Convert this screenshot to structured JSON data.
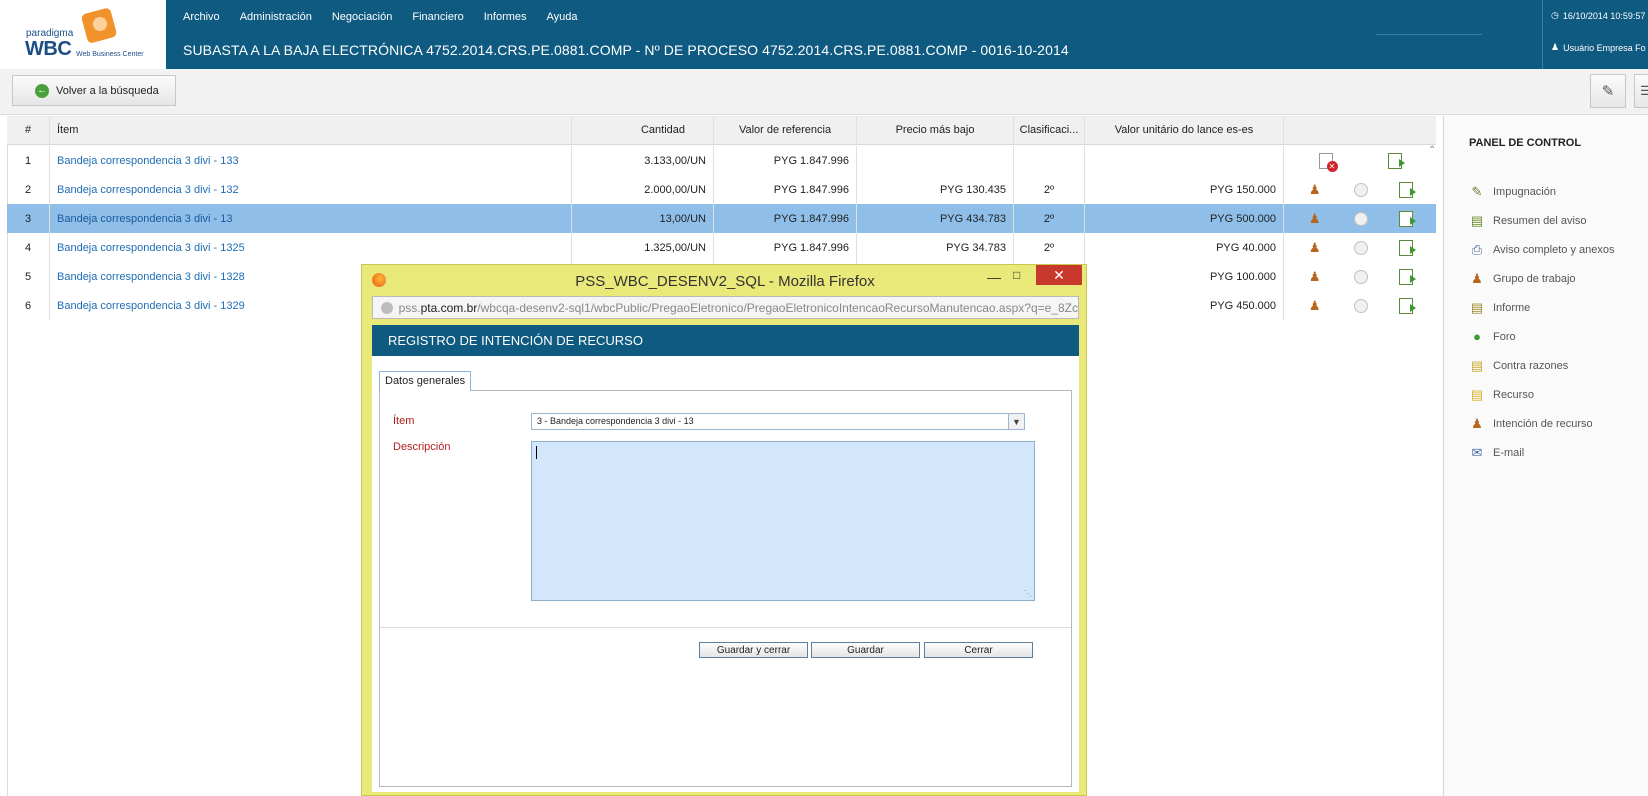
{
  "brand": {
    "small": "paradigma",
    "name": "WBC",
    "tagline": "Web Business Center"
  },
  "menu": [
    "Archivo",
    "Administración",
    "Negociación",
    "Financiero",
    "Informes",
    "Ayuda"
  ],
  "page_title": "SUBASTA A LA BAJA ELECTRÓNICA 4752.2014.CRS.PE.0881.COMP - Nº DE PROCESO 4752.2014.CRS.PE.0881.COMP - 0016-10-2014",
  "datetime": "16/10/2014 10:59:57",
  "user": "Usuário Empresa Fo",
  "toolbar": {
    "back_label": "Volver a la búsqueda"
  },
  "table": {
    "headers": [
      "#",
      "Ítem",
      "Cantidad",
      "Valor de referencia",
      "Precio más bajo",
      "Clasificaci...",
      "Valor unitário do lance es-es",
      ""
    ],
    "rows": [
      {
        "n": "1",
        "item": "Bandeja correspondencia 3 divi - 133",
        "qty": "3.133,00/UN",
        "ref": "PYG 1.847.996",
        "low": "",
        "rank": "",
        "bid": ""
      },
      {
        "n": "2",
        "item": "Bandeja correspondencia 3 divi - 132",
        "qty": "2.000,00/UN",
        "ref": "PYG 1.847.996",
        "low": "PYG 130.435",
        "rank": "2º",
        "bid": "PYG 150.000"
      },
      {
        "n": "3",
        "item": "Bandeja correspondencia 3 divi - 13",
        "qty": "13,00/UN",
        "ref": "PYG 1.847.996",
        "low": "PYG 434.783",
        "rank": "2º",
        "bid": "PYG 500.000"
      },
      {
        "n": "4",
        "item": "Bandeja correspondencia 3 divi - 1325",
        "qty": "1.325,00/UN",
        "ref": "PYG 1.847.996",
        "low": "PYG 34.783",
        "rank": "2º",
        "bid": "PYG 40.000"
      },
      {
        "n": "5",
        "item": "Bandeja correspondencia 3 divi - 1328",
        "qty": "",
        "ref": "",
        "low": "",
        "rank": "",
        "bid": "PYG 100.000"
      },
      {
        "n": "6",
        "item": "Bandeja correspondencia 3 divi - 1329",
        "qty": "",
        "ref": "",
        "low": "",
        "rank": "",
        "bid": "PYG 450.000"
      }
    ],
    "selected_row": "3"
  },
  "panel": {
    "title": "PANEL DE CONTROL",
    "items": [
      {
        "label": "Impugnación",
        "icon": "pencil-icon"
      },
      {
        "label": "Resumen del aviso",
        "icon": "clipboard-icon"
      },
      {
        "label": "Aviso completo y anexos",
        "icon": "attachment-icon"
      },
      {
        "label": "Grupo de trabajo",
        "icon": "people-icon"
      },
      {
        "label": "Informe",
        "icon": "report-icon"
      },
      {
        "label": "Foro",
        "icon": "forum-icon"
      },
      {
        "label": "Contra razones",
        "icon": "notes-icon"
      },
      {
        "label": "Recurso",
        "icon": "folder-icon"
      },
      {
        "label": "Intención de recurso",
        "icon": "people-icon"
      },
      {
        "label": "E-mail",
        "icon": "mail-icon"
      }
    ]
  },
  "popup": {
    "window_title": "PSS_WBC_DESENV2_SQL - Mozilla Firefox",
    "url_prefix": "pss.",
    "url_domain": "pta.com.br",
    "url_path": "/wbcqa-desenv2-sql1/wbcPublic/PregaoEletronico/PregaoEletronicoIntencaoRecursoManutencao.aspx?q=e_8Zc",
    "header": "REGISTRO DE INTENCIÓN DE RECURSO",
    "tab": "Datos generales",
    "item_label": "Ítem",
    "item_value": "3 - Bandeja correspondencia 3 divi - 13",
    "description_label": "Descripción",
    "description_value": "",
    "buttons": {
      "save_close": "Guardar y cerrar",
      "save": "Guardar",
      "close": "Cerrar"
    }
  },
  "colors": {
    "header_bg": "#0e5a80",
    "selected_row": "#8fbfe9",
    "popup_frame": "#e9e97a",
    "link": "#1f6db5",
    "required_label": "#b41e1e"
  }
}
